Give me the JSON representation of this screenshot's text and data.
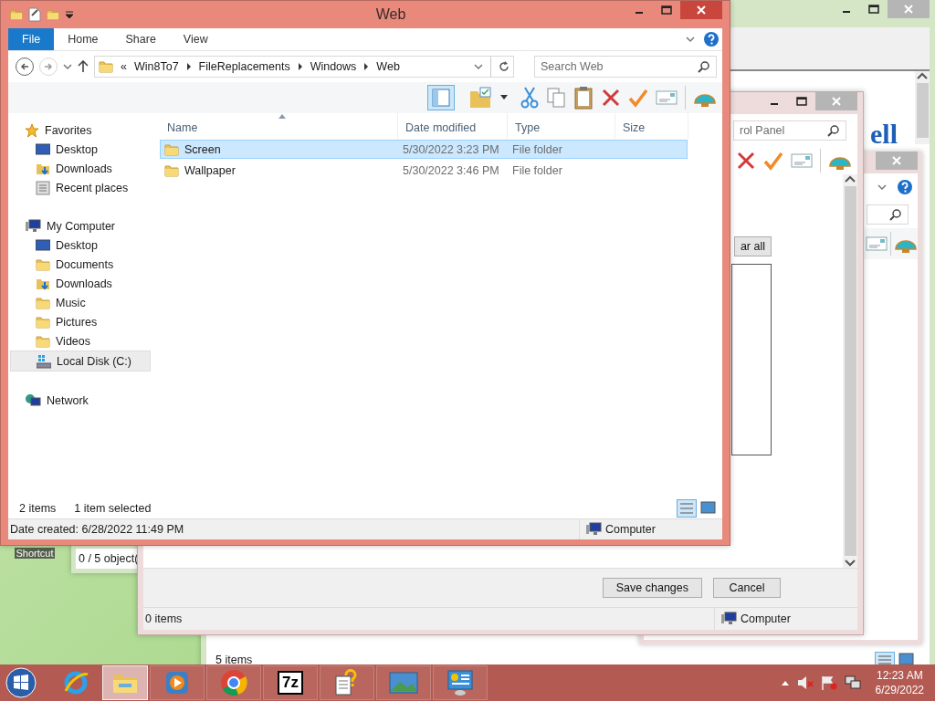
{
  "desktop_icons": [
    {
      "label": "Shortcut"
    }
  ],
  "side_window": {
    "status": "0 / 5 object("
  },
  "back_window": {
    "heading": "ell",
    "status": "5 items"
  },
  "middle_window": {
    "search_placeholder": "rol Panel",
    "clear_button": "ar all",
    "buttons": [
      "Save changes",
      "Cancel"
    ],
    "status": "0 items",
    "location": "Computer"
  },
  "front_window": {
    "title": "Web",
    "ribbon_tabs": [
      {
        "label": "File",
        "selected": true
      },
      {
        "label": "Home",
        "selected": false
      },
      {
        "label": "Share",
        "selected": false
      },
      {
        "label": "View",
        "selected": false
      }
    ],
    "nav_buttons": [
      {
        "kind": "back",
        "disabled": false
      },
      {
        "kind": "forward",
        "disabled": true
      }
    ],
    "breadcrumb": {
      "overflow": "«",
      "parts": [
        "Win8To7",
        "FileReplacements",
        "Windows",
        "Web"
      ]
    },
    "search": {
      "placeholder": "Search Web"
    },
    "columns": [
      {
        "label": "Name",
        "sorted": true
      },
      {
        "label": "Date modified",
        "sorted": false
      },
      {
        "label": "Type",
        "sorted": false
      },
      {
        "label": "Size",
        "sorted": false
      }
    ],
    "rows": [
      {
        "name": "Screen",
        "date": "5/30/2022 3:23 PM",
        "type": "File folder",
        "size": "",
        "selected": true
      },
      {
        "name": "Wallpaper",
        "date": "5/30/2022 3:46 PM",
        "type": "File folder",
        "size": "",
        "selected": false
      }
    ],
    "nav_pane": [
      {
        "label": "Favorites",
        "kind": "star",
        "selected": false,
        "children": [
          {
            "label": "Desktop",
            "kind": "desktop",
            "selected": false
          },
          {
            "label": "Downloads",
            "kind": "downloads",
            "selected": false
          },
          {
            "label": "Recent places",
            "kind": "recent",
            "selected": false
          }
        ]
      },
      {
        "label": "My Computer",
        "kind": "computer",
        "selected": false,
        "children": [
          {
            "label": "Desktop",
            "kind": "desktop",
            "selected": false
          },
          {
            "label": "Documents",
            "kind": "documents",
            "selected": false
          },
          {
            "label": "Downloads",
            "kind": "downloads",
            "selected": false
          },
          {
            "label": "Music",
            "kind": "music",
            "selected": false
          },
          {
            "label": "Pictures",
            "kind": "pictures",
            "selected": false
          },
          {
            "label": "Videos",
            "kind": "videos",
            "selected": false
          },
          {
            "label": "Local Disk (C:)",
            "kind": "drive",
            "selected": true
          }
        ]
      },
      {
        "label": "Network",
        "kind": "network",
        "selected": false
      }
    ],
    "status": {
      "count": "2 items",
      "selection": "1 item selected"
    },
    "details": {
      "date_created": "Date created: 6/28/2022 11:49 PM",
      "location": "Computer"
    }
  },
  "taskbar": {
    "apps": [
      {
        "kind": "ie",
        "active": false
      },
      {
        "kind": "explorer",
        "active": true
      },
      {
        "kind": "media",
        "active": false
      },
      {
        "kind": "chrome",
        "active": false
      },
      {
        "kind": "archiver",
        "label": "7z",
        "active": false
      },
      {
        "kind": "help",
        "active": false
      },
      {
        "kind": "photo",
        "active": false
      },
      {
        "kind": "control",
        "active": false
      }
    ],
    "time": "12:23 AM",
    "date": "6/29/2022"
  }
}
